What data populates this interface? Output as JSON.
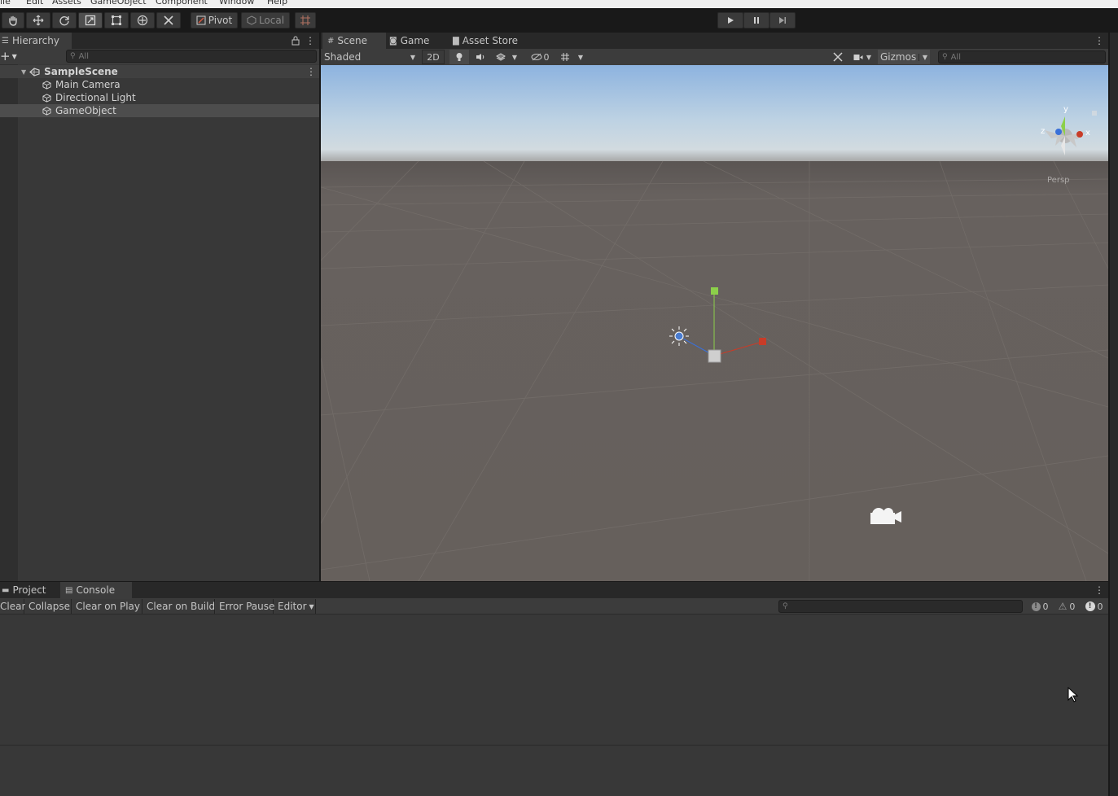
{
  "menu": {
    "items": [
      "ile",
      "Edit",
      "Assets",
      "GameObject",
      "Component",
      "Window",
      "Help"
    ]
  },
  "toolbar": {
    "tools": [
      "hand-tool",
      "move-tool",
      "rotate-tool",
      "scale-tool",
      "rect-tool",
      "transform-tool",
      "custom-editor-tool"
    ],
    "active_tool": "scale-tool",
    "pivot_label": "Pivot",
    "local_label": "Local",
    "play_controls": [
      "play",
      "pause",
      "step"
    ]
  },
  "hierarchy": {
    "tab_label": "Hierarchy",
    "search_placeholder": "All",
    "scene_name": "SampleScene",
    "items": [
      {
        "label": "Main Camera"
      },
      {
        "label": "Directional Light"
      },
      {
        "label": "GameObject",
        "selected": true
      }
    ]
  },
  "scene_view": {
    "tabs": [
      {
        "label": "Scene",
        "icon": "grid-icon",
        "active": true
      },
      {
        "label": "Game",
        "icon": "gamepad-icon",
        "active": false
      },
      {
        "label": "Asset Store",
        "icon": "store-bag-icon",
        "active": false
      }
    ],
    "shading_mode": "Shaded",
    "mode_2d": "2D",
    "hidden_count": "0",
    "gizmos_label": "Gizmos",
    "search_placeholder": "All",
    "projection_label": "Persp",
    "axis_labels": {
      "y": "y",
      "x": "x",
      "z": "z"
    },
    "colors": {
      "sky_top": "#8fb3df",
      "ground": "#655f5c",
      "x_axis": "#c83c28",
      "y_axis": "#8cd04a",
      "z_axis": "#3a70d8"
    }
  },
  "console": {
    "tabs": [
      {
        "label": "Project",
        "icon": "folder-icon",
        "active": false
      },
      {
        "label": "Console",
        "icon": "console-icon",
        "active": true
      }
    ],
    "buttons": {
      "clear": "Clear",
      "collapse": "Collapse",
      "clear_on_play": "Clear on Play",
      "clear_on_build": "Clear on Build",
      "error_pause": "Error Pause",
      "editor": "Editor"
    },
    "counts": {
      "info": "0",
      "warnings": "0",
      "errors": "0"
    }
  }
}
